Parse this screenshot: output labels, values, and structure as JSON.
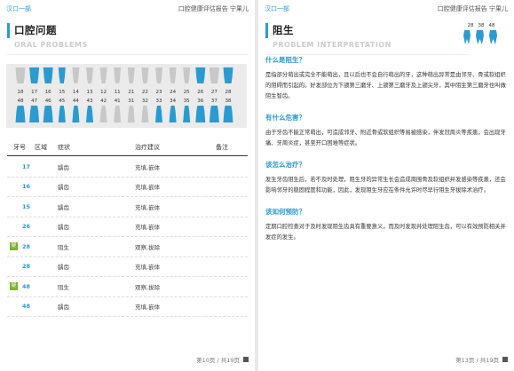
{
  "header": {
    "org": "汉口一部",
    "report": "口腔健康评估报告 宁果儿"
  },
  "left": {
    "title_cn": "口腔问题",
    "title_en": "ORAL PROBLEMS",
    "upper_numbers": [
      "18",
      "17",
      "16",
      "15",
      "14",
      "13",
      "12",
      "11",
      "21",
      "22",
      "23",
      "24",
      "25",
      "26",
      "27",
      "28"
    ],
    "lower_numbers": [
      "48",
      "47",
      "46",
      "45",
      "44",
      "43",
      "42",
      "41",
      "31",
      "32",
      "33",
      "34",
      "35",
      "36",
      "37",
      "38"
    ],
    "table_headers": {
      "tooth": "牙号",
      "area": "区域",
      "symptom": "症状",
      "advice": "治疗建议",
      "note": "备注"
    },
    "rows": [
      {
        "tooth": "17",
        "badge": "",
        "symptom": "龋齿",
        "advice": "充填,嵌体"
      },
      {
        "tooth": "16",
        "badge": "",
        "symptom": "龋齿",
        "advice": "充填,嵌体"
      },
      {
        "tooth": "15",
        "badge": "",
        "symptom": "龋齿",
        "advice": "充填,嵌体"
      },
      {
        "tooth": "26",
        "badge": "",
        "symptom": "龋齿",
        "advice": "充填,嵌体"
      },
      {
        "tooth": "28",
        "badge": "疑",
        "symptom": "阻生",
        "advice": "观察,拔除"
      },
      {
        "tooth": "28",
        "badge": "",
        "symptom": "龋齿",
        "advice": "充填,嵌体"
      },
      {
        "tooth": "48",
        "badge": "疑",
        "symptom": "阻生",
        "advice": "观察,拔除"
      },
      {
        "tooth": "48",
        "badge": "",
        "symptom": "龋齿",
        "advice": "充填,嵌体"
      }
    ],
    "footer": "第10页 / 共19页"
  },
  "right": {
    "title_cn": "阻生",
    "title_en": "PROBLEM INTERPRETATION",
    "mini_numbers": [
      "28",
      "38",
      "48"
    ],
    "sections": [
      {
        "q": "什么是阻生？",
        "a": "是指部分萌出或完全不能萌出，且以后也不会自行萌出的牙，这种萌出异常是由邻牙、骨或软组织的阻碍而引起的。好发部位为下颌第三磨牙、上颌第三磨牙及上颌尖牙，其中阻生第三磨牙也叫做阻生智齿。"
      },
      {
        "q": "有什么危害？",
        "a": "由于牙齿不能正常萌出，可造成邻牙、附近骨或软组织等易被感染，伴发冠周炎等疾患，会出现牙痛、牙周炎症，甚至开口困难等症状。"
      },
      {
        "q": "该怎么治疗？",
        "a": "发生牙齿阻生后，若不及时处理，阻生牙的异常生长会造成周围骨及软组织并发感染等疾患，还会影响邻牙的稳固程度和功能，因此，发现阻生牙应在条件允许时尽早行阻生牙拔除术治疗。"
      },
      {
        "q": "该如何预防？",
        "a": "定期口腔检查对于及时发现阻生齿具有重要意义，而及时发现并处理阻生齿，可以有效预防相关并发症的发生。"
      }
    ],
    "footer": "第13页 / 共19页"
  },
  "colors": {
    "accent": "#2a9bd0",
    "badge": "#7ab32c",
    "tooth_grey": "#c8c8c8"
  }
}
